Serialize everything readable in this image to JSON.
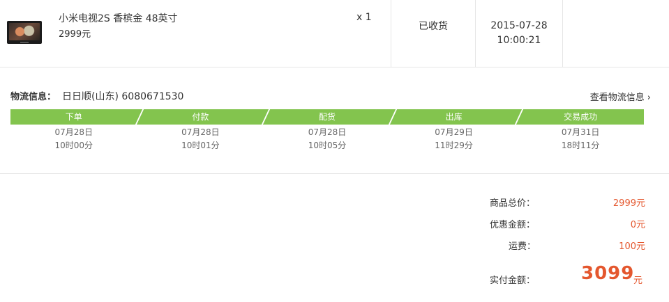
{
  "order": {
    "product_name": "小米电视2S 香槟金 48英寸",
    "price": "2999元",
    "quantity": "x 1",
    "status": "已收货",
    "date": "2015-07-28",
    "time": "10:00:21",
    "thumbnail_icon": "tv-thumbnail"
  },
  "logistics": {
    "label": "物流信息：",
    "company": "日日顺(山东) 6080671530",
    "view_link": "查看物流信息",
    "link_icon": "chevron-right-icon",
    "bar_color": "#83c44e",
    "steps": [
      {
        "name": "下单",
        "date": "07月28日",
        "time": "10时00分"
      },
      {
        "name": "付款",
        "date": "07月28日",
        "time": "10时01分"
      },
      {
        "name": "配货",
        "date": "07月28日",
        "time": "10时05分"
      },
      {
        "name": "出库",
        "date": "07月29日",
        "time": "11时29分"
      },
      {
        "name": "交易成功",
        "date": "07月31日",
        "time": "18时11分"
      }
    ]
  },
  "summary": {
    "goods_total_label": "商品总价：",
    "goods_total_value": "2999元",
    "discount_label": "优惠金额：",
    "discount_value": "0元",
    "shipping_label": "运费：",
    "shipping_value": "100元",
    "paid_label": "实付金额：",
    "paid_value": "3099",
    "paid_unit": "元",
    "accent_color": "#e4572e"
  }
}
